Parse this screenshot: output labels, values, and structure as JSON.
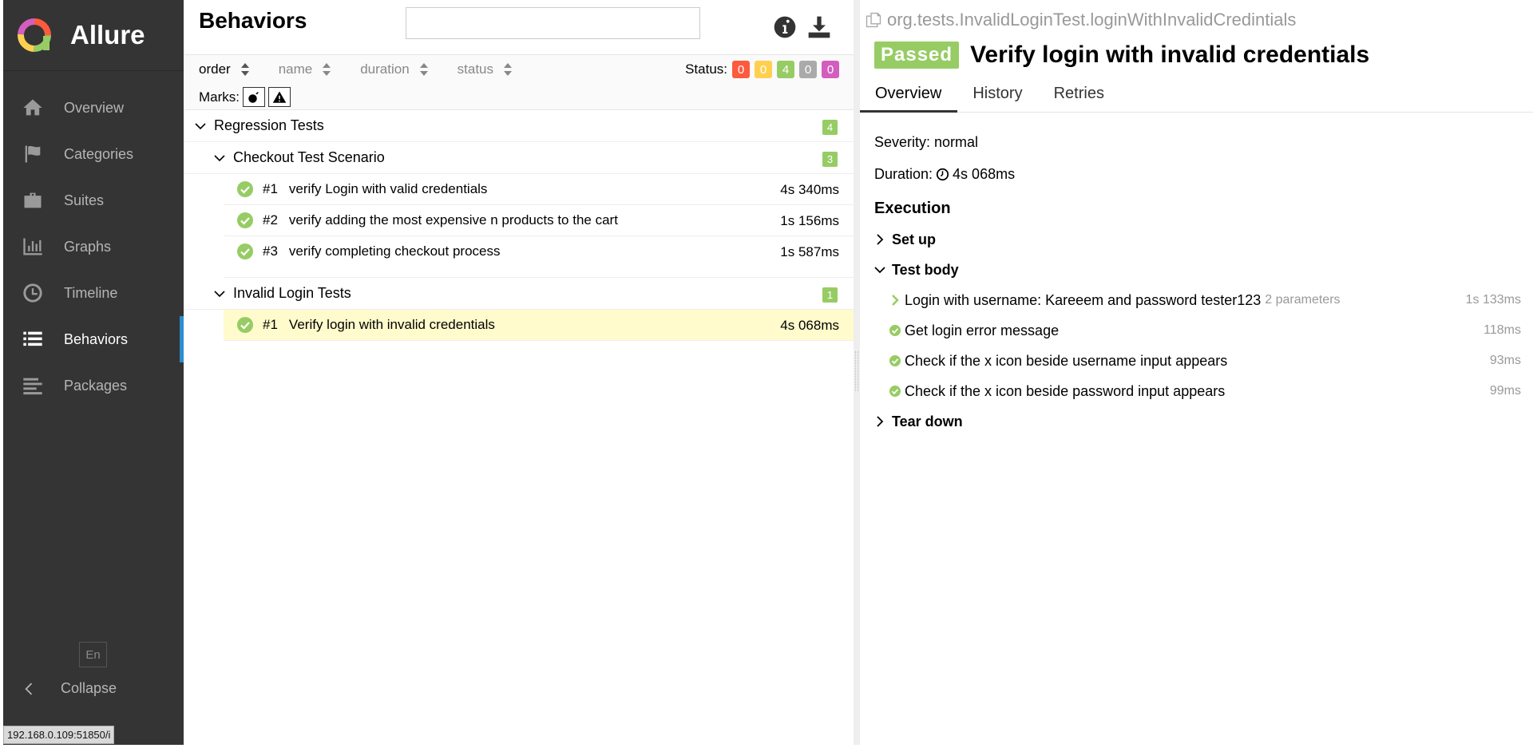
{
  "sidebar": {
    "brand": "Allure",
    "items": [
      {
        "label": "Overview",
        "icon": "home-icon"
      },
      {
        "label": "Categories",
        "icon": "flag-icon"
      },
      {
        "label": "Suites",
        "icon": "briefcase-icon"
      },
      {
        "label": "Graphs",
        "icon": "bar-chart-icon"
      },
      {
        "label": "Timeline",
        "icon": "clock-icon"
      },
      {
        "label": "Behaviors",
        "icon": "list-icon",
        "active": true
      },
      {
        "label": "Packages",
        "icon": "align-left-icon"
      }
    ],
    "language": "En",
    "collapse_label": "Collapse",
    "status_url": "192.168.0.109:51850/i"
  },
  "middle": {
    "title": "Behaviors",
    "search": {
      "value": "",
      "placeholder": ""
    },
    "sort": {
      "order": "order",
      "name": "name",
      "duration": "duration",
      "status": "status"
    },
    "marks_label": "Marks:",
    "status_label": "Status:",
    "status_counts": [
      {
        "value": "0",
        "color": "#fd5a3e"
      },
      {
        "value": "0",
        "color": "#ffd050"
      },
      {
        "value": "4",
        "color": "#97cc64"
      },
      {
        "value": "0",
        "color": "#aaaaaa"
      },
      {
        "value": "0",
        "color": "#d35ebe"
      }
    ],
    "tree": {
      "root": {
        "name": "Regression Tests",
        "count": "4"
      },
      "groups": [
        {
          "name": "Checkout Test Scenario",
          "count": "3",
          "tests": [
            {
              "num": "#1",
              "name": "verify Login with valid credentials",
              "duration": "4s 340ms"
            },
            {
              "num": "#2",
              "name": "verify adding the most expensive n products to the cart",
              "duration": "1s 156ms"
            },
            {
              "num": "#3",
              "name": "verify completing checkout process",
              "duration": "1s 587ms"
            }
          ]
        },
        {
          "name": "Invalid Login Tests",
          "count": "1",
          "tests": [
            {
              "num": "#1",
              "name": "Verify login with invalid credentials",
              "duration": "4s 068ms"
            }
          ]
        }
      ]
    }
  },
  "right": {
    "full_name": "org.tests.InvalidLoginTest.loginWithInvalidCredintials",
    "status": "Passed",
    "title": "Verify login with invalid credentials",
    "tabs": [
      "Overview",
      "History",
      "Retries"
    ],
    "severity": "Severity: normal",
    "duration_label": "Duration:",
    "duration": "4s 068ms",
    "execution_title": "Execution",
    "setup": "Set up",
    "test_body": "Test body",
    "steps": [
      {
        "name": "Login with username: Kareeem and password tester123",
        "params": "2 parameters",
        "duration": "1s 133ms"
      },
      {
        "name": "Get login error message",
        "duration": "118ms"
      },
      {
        "name": "Check if the x icon beside username input appears",
        "duration": "93ms"
      },
      {
        "name": "Check if the x icon beside password input appears",
        "duration": "99ms"
      }
    ],
    "teardown": "Tear down"
  },
  "colors": {
    "sidebar_bg": "#343434",
    "passed": "#97cc64",
    "selected_row": "#fffbcc",
    "active_accent": "#2c8ccd"
  }
}
